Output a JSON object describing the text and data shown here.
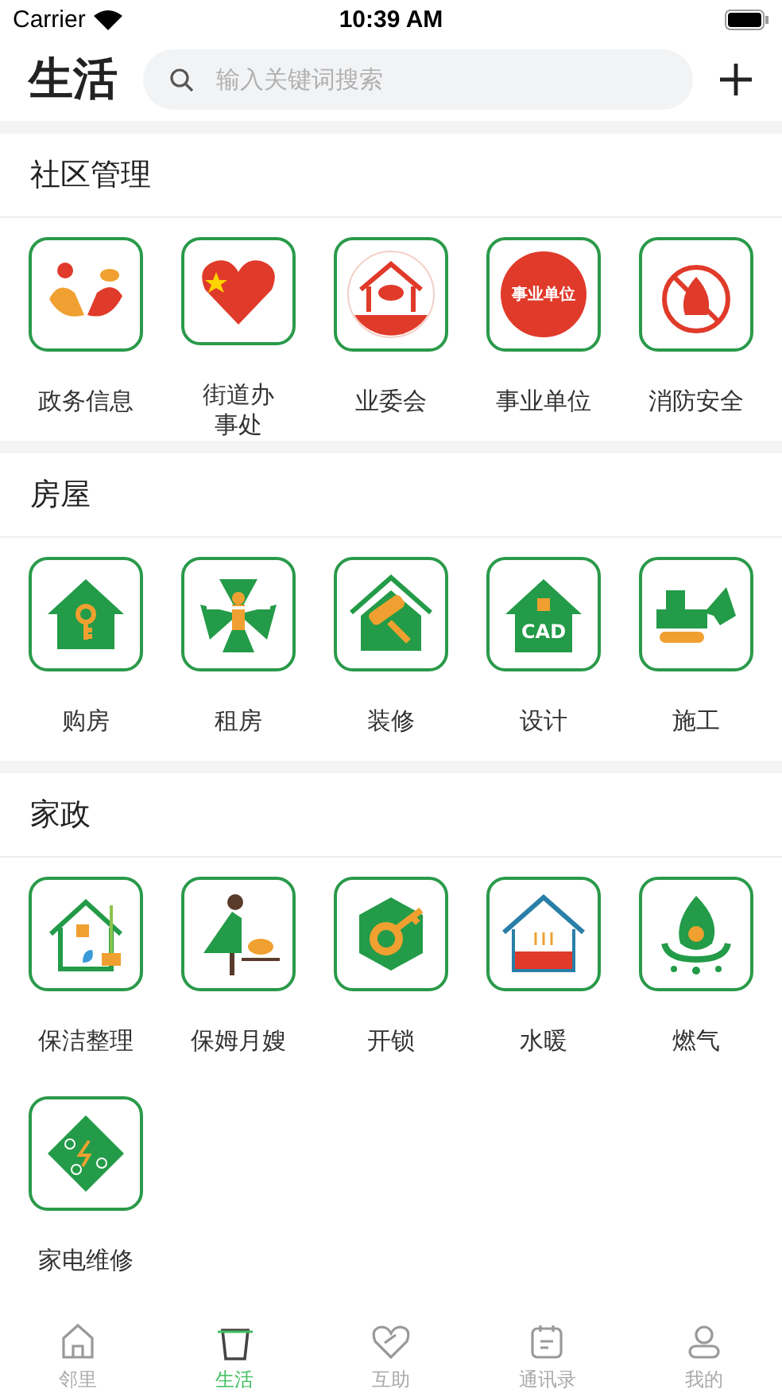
{
  "status_bar": {
    "carrier": "Carrier",
    "time": "10:39 AM"
  },
  "header": {
    "title": "生活",
    "search": {
      "placeholder": "输入关键词搜索"
    }
  },
  "sections": [
    {
      "title": "社区管理",
      "items": [
        {
          "label": "政务信息"
        },
        {
          "label": "街道办事处"
        },
        {
          "label": "业委会"
        },
        {
          "label": "事业单位",
          "badge": "事业单位"
        },
        {
          "label": "消防安全"
        }
      ]
    },
    {
      "title": "房屋",
      "items": [
        {
          "label": "购房"
        },
        {
          "label": "租房"
        },
        {
          "label": "装修"
        },
        {
          "label": "设计",
          "badge": "CAD"
        },
        {
          "label": "施工"
        }
      ]
    },
    {
      "title": "家政",
      "items": [
        {
          "label": "保洁整理"
        },
        {
          "label": "保姆月嫂"
        },
        {
          "label": "开锁"
        },
        {
          "label": "水暖"
        },
        {
          "label": "燃气"
        },
        {
          "label": "家电维修"
        }
      ]
    }
  ],
  "tab_bar": [
    {
      "label": "邻里",
      "selected": false
    },
    {
      "label": "生活",
      "selected": true
    },
    {
      "label": "互助",
      "selected": false
    },
    {
      "label": "通讯录",
      "selected": false
    },
    {
      "label": "我的",
      "selected": false
    }
  ]
}
